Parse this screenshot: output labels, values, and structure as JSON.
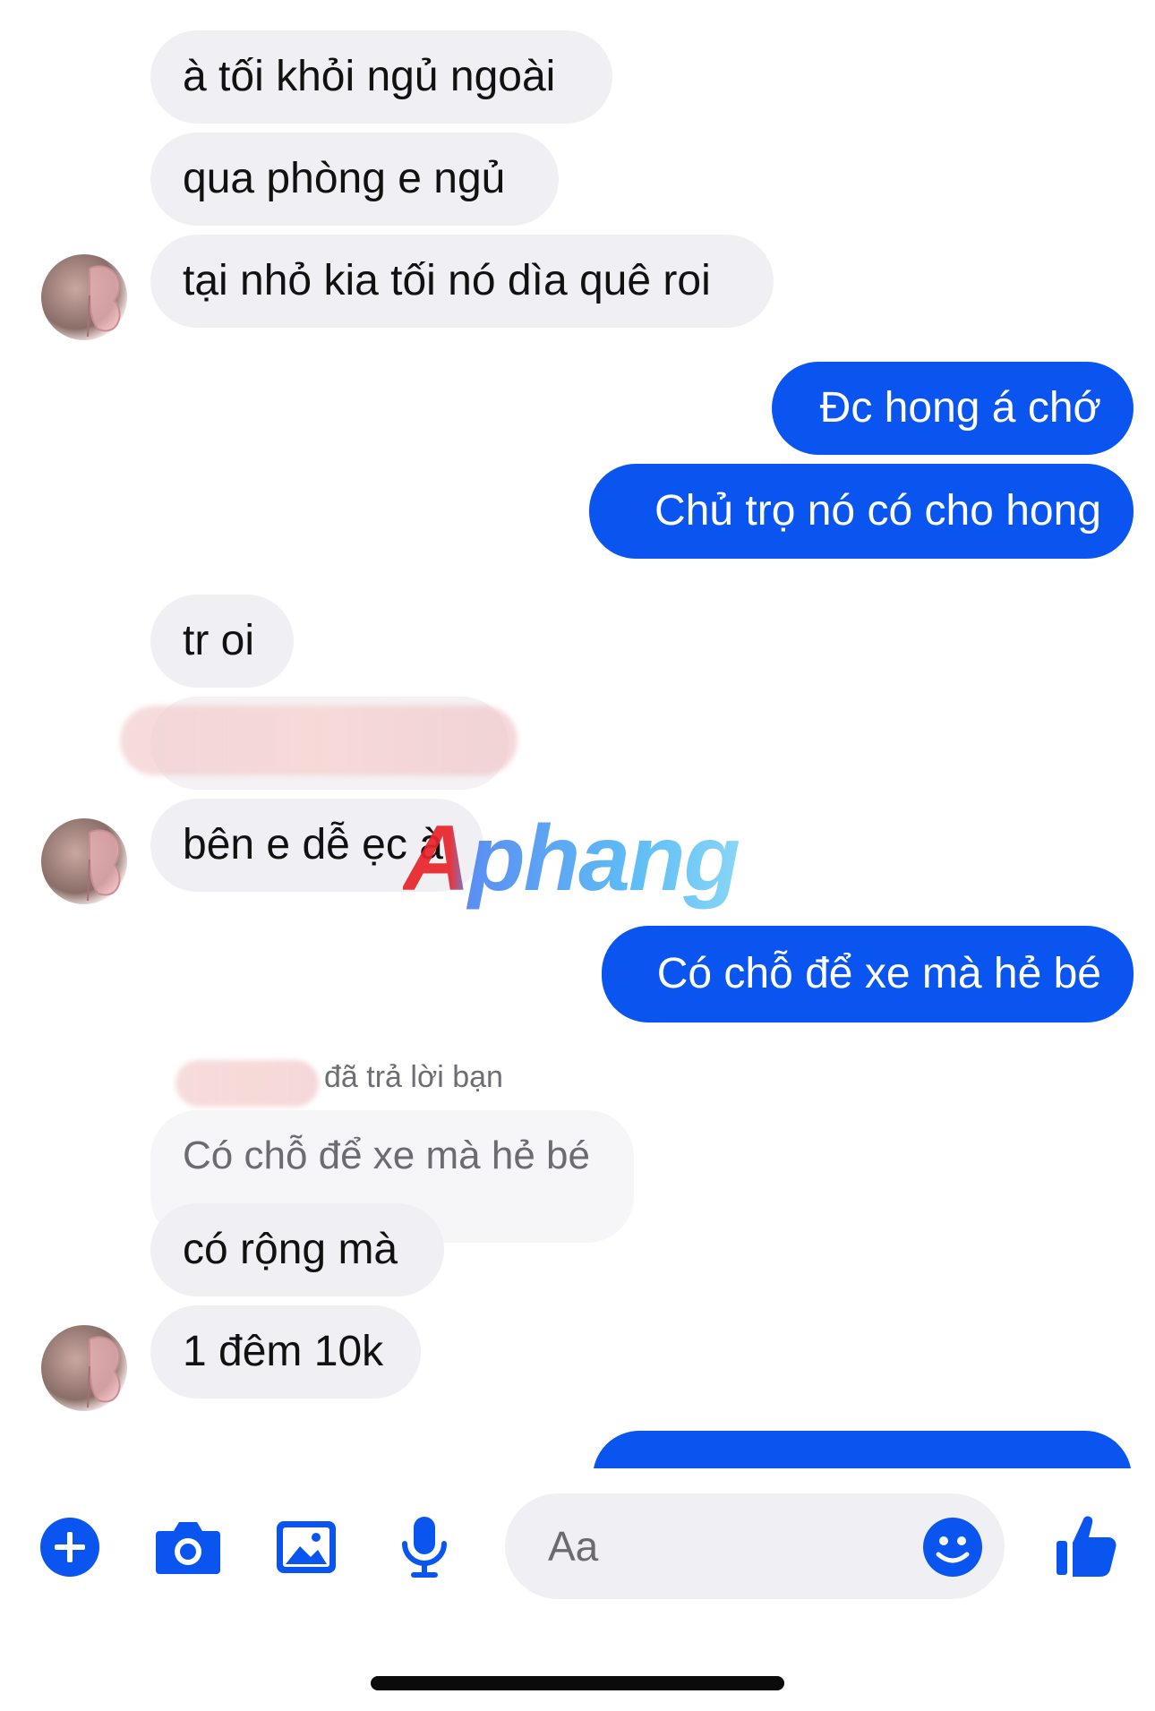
{
  "messages": {
    "m1": "à tối khỏi ngủ ngoài",
    "m2": "qua phòng e ngủ",
    "m3": "tại nhỏ kia tối nó dìa quê roi",
    "m4": "Đc hong á chớ",
    "m5": "Chủ trọ nó có cho hong",
    "m6": "tr oi",
    "m7": "bên e dễ ẹc à",
    "m8": "Có chỗ để xe mà hẻ bé",
    "reply_meta": "đã trả lời bạn",
    "quoted": "Có chỗ để xe mà hẻ bé",
    "m9": "có rộng mà",
    "m10": "1 đêm 10k"
  },
  "watermark": {
    "text": "Aphang"
  },
  "composer": {
    "placeholder": "Aa",
    "icons": [
      "plus-icon",
      "camera-icon",
      "image-icon",
      "microphone-icon",
      "emoji-icon",
      "thumbs-up-icon"
    ]
  },
  "colors": {
    "outgoing_bubble": "#0a55f0",
    "incoming_bubble": "#f0f0f4",
    "icon_blue": "#0a55f0"
  }
}
